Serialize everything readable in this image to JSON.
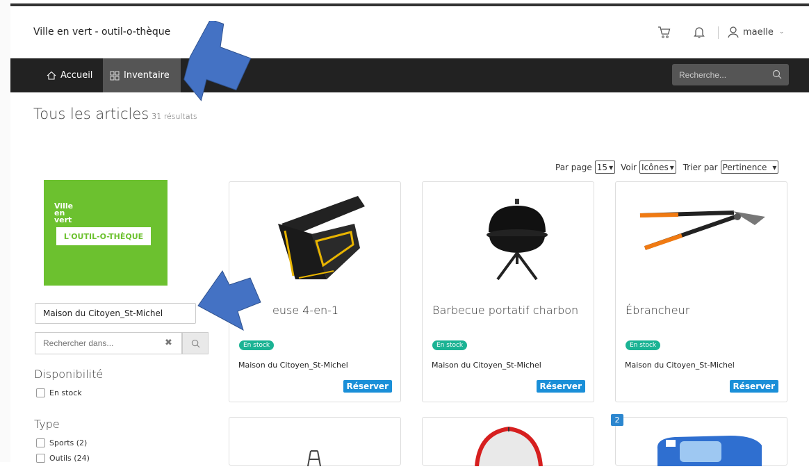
{
  "header": {
    "brand": "Ville en vert - outil-o-thèque",
    "user": "maelle"
  },
  "nav": {
    "home": "Accueil",
    "inventory": "Inventaire",
    "search_placeholder": "Recherche..."
  },
  "page": {
    "title": "Tous les articles",
    "count": "31 résultats"
  },
  "controls": {
    "per_page_label": "Par page",
    "per_page_value": "15",
    "view_label": "Voir",
    "view_value": "Icônes",
    "sort_label": "Trier par",
    "sort_value": "Pertinence"
  },
  "sidebar": {
    "logo_ville": "Ville en vert",
    "logo_text": "L'OUTIL-O-THÈQUE",
    "location": "Maison du Citoyen_St-Michel",
    "search_placeholder": "Rechercher dans...",
    "facets": [
      {
        "title": "Disponibilité",
        "items": [
          "En stock"
        ]
      },
      {
        "title": "Type",
        "items": [
          "Sports (2)",
          "Outils (24)"
        ]
      }
    ]
  },
  "cards": [
    {
      "name": "euse 4-en-1",
      "stock": "En stock",
      "location": "Maison du Citoyen_St-Michel",
      "button": "Réserver"
    },
    {
      "name": "Barbecue portatif charbon",
      "stock": "En stock",
      "location": "Maison du Citoyen_St-Michel",
      "button": "Réserver"
    },
    {
      "name": "Ébrancheur",
      "stock": "En stock",
      "location": "Maison du Citoyen_St-Michel",
      "button": "Réserver"
    }
  ],
  "second_row_badge": "2",
  "colors": {
    "navbar": "#222222",
    "logo_green": "#6cc12f",
    "stock_badge": "#1bb394",
    "reserve": "#1a8fd8",
    "arrow": "#4472c4"
  }
}
